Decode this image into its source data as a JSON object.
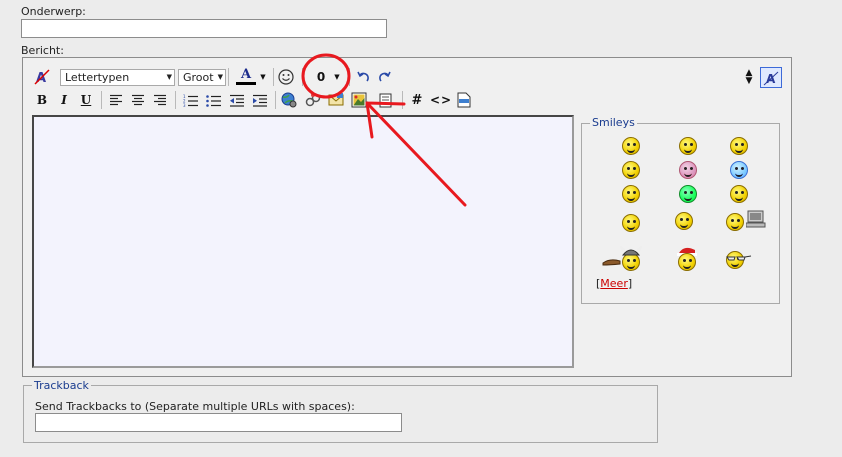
{
  "form": {
    "subject_label": "Onderwerp:",
    "message_label": "Bericht:"
  },
  "toolbar": {
    "font_select": "Lettertypen",
    "size_select": "Groot",
    "color_letter": "A",
    "bold": "B",
    "italic": "I",
    "underline": "U",
    "hash": "#",
    "code": "<>",
    "attachment": "0"
  },
  "smileys": {
    "title": "Smileys",
    "more_prefix": "[",
    "more_link": "Meer",
    "more_suffix": "]"
  },
  "trackback": {
    "title": "Trackback",
    "label": "Send Trackbacks to (Separate multiple URLs with spaces):"
  },
  "colors": {
    "annotation": "#e8191f",
    "editor_bg": "#f3f3fd",
    "link": "#cc0000",
    "fieldset_title": "#1a3c8f"
  }
}
